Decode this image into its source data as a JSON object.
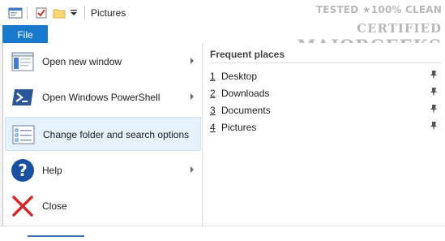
{
  "window": {
    "title": "Pictures"
  },
  "qat": {
    "icons": [
      "properties-icon",
      "checkbox-icon",
      "folder-icon",
      "customize-qat-icon"
    ]
  },
  "ribbon": {
    "file_tab_label": "File"
  },
  "file_menu": {
    "items": [
      {
        "label": "Open new window",
        "icon": "new-window-icon",
        "has_submenu": true
      },
      {
        "label": "Open Windows PowerShell",
        "icon": "powershell-icon",
        "has_submenu": true
      },
      {
        "label": "Change folder and search options",
        "icon": "folder-options-icon",
        "has_submenu": false,
        "highlighted": true
      },
      {
        "label": "Help",
        "icon": "help-icon",
        "has_submenu": true
      },
      {
        "label": "Close",
        "icon": "close-icon",
        "has_submenu": false
      }
    ],
    "frequent_places": {
      "title": "Frequent places",
      "items": [
        {
          "number": "1",
          "name": "Desktop"
        },
        {
          "number": "2",
          "name": "Downloads"
        },
        {
          "number": "3",
          "name": "Documents"
        },
        {
          "number": "4",
          "name": "Pictures"
        }
      ]
    }
  },
  "watermark": {
    "line1": "TESTED ★100% CLEAN",
    "line2": "CERTIFIED",
    "line3": "MAJORGEEKS"
  },
  "colors": {
    "file_tab": "#1979ca",
    "hover_bg": "#e5f1fb",
    "powershell_blue": "#2b5797",
    "help_blue": "#1b4fa0",
    "close_red": "#d22a2a"
  }
}
